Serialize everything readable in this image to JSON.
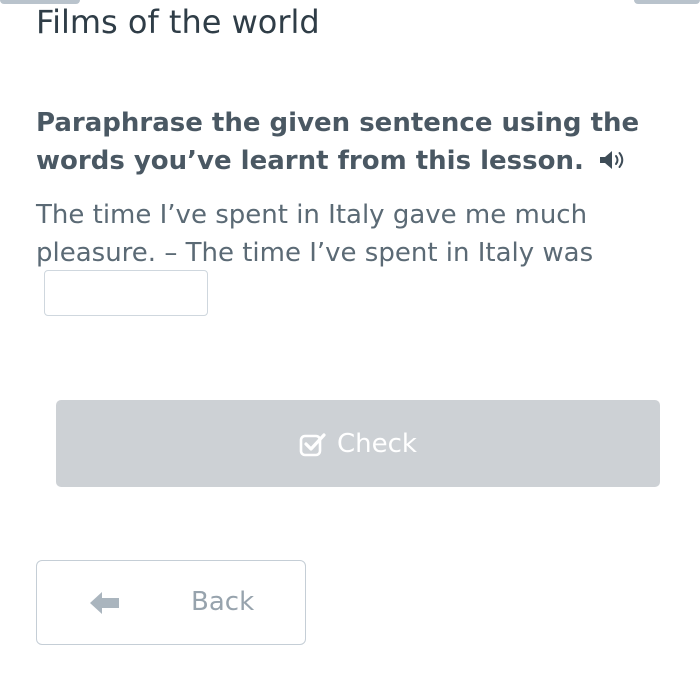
{
  "header": {
    "title": "Films of the world"
  },
  "exercise": {
    "instruction": "Paraphrase the given sentence using the words you’ve learnt from this lesson.",
    "speaker_icon": "speaker-icon",
    "sentence": "The time I’ve spent in Italy gave me much pleasure. – The time I’ve spent in Italy was",
    "answer": {
      "value": "",
      "placeholder": ""
    }
  },
  "actions": {
    "check_label": "Check",
    "check_icon": "check-square-icon",
    "back_label": "Back",
    "back_icon": "arrow-left-icon"
  },
  "colors": {
    "title": "#2f3d47",
    "instruction": "#4a5863",
    "body_text": "#5b6a75",
    "check_disabled_bg": "#cdd1d5",
    "back_text": "#97a3ad",
    "back_icon": "#aab5be"
  }
}
